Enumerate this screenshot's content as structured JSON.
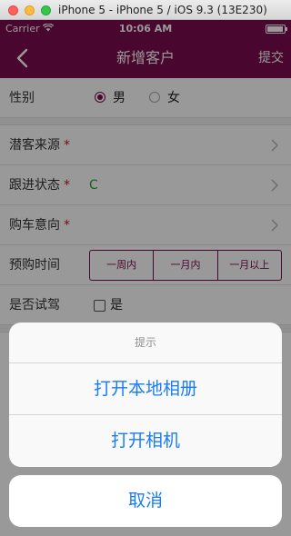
{
  "simulator": {
    "title": "iPhone 5 - iPhone 5 / iOS 9.3 (13E230)"
  },
  "status_bar": {
    "carrier": "Carrier",
    "time": "10:06 AM"
  },
  "nav": {
    "title": "新增客户",
    "submit_label": "提交"
  },
  "form": {
    "gender": {
      "label": "性别",
      "options": [
        "男",
        "女"
      ],
      "selected": "男"
    },
    "source": {
      "label": "潜客来源",
      "required_mark": "*"
    },
    "follow_status": {
      "label": "跟进状态",
      "required_mark": "*",
      "value": "C"
    },
    "purchase_intent": {
      "label": "购车意向",
      "required_mark": "*"
    },
    "purchase_time": {
      "label": "预购时间",
      "options": [
        "一周内",
        "一月内",
        "一月以上"
      ]
    },
    "test_drive": {
      "label": "是否试驾",
      "option": "是",
      "checked": false
    }
  },
  "action_sheet": {
    "title": "提示",
    "buttons": [
      "打开本地相册",
      "打开相机"
    ],
    "cancel_label": "取消"
  },
  "colors": {
    "brand": "#7b0d4f",
    "ios_blue": "#1a7cf5",
    "required": "#c8102e",
    "status_c": "#2ca02c"
  }
}
